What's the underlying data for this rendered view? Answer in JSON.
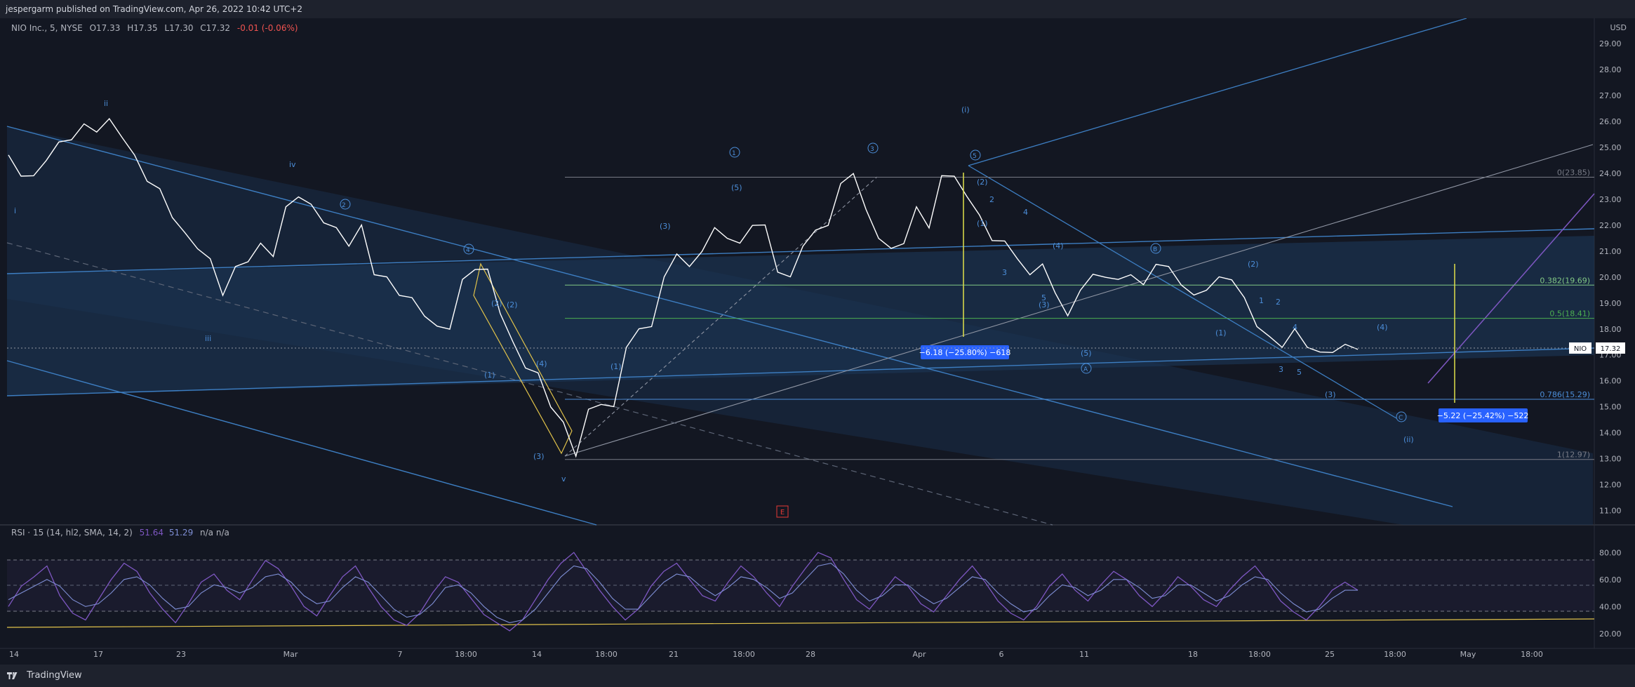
{
  "header": {
    "published": "jespergarm published on TradingView.com, Apr 26, 2022 10:42 UTC+2"
  },
  "legend": {
    "symbol": "NIO Inc., 5, NYSE",
    "open": "O17.33",
    "high": "H17.35",
    "low": "L17.30",
    "close": "C17.32",
    "change": "-0.01 (-0.06%)"
  },
  "currency": "USD",
  "price_tag": {
    "symbol": "NIO",
    "price": "17.32"
  },
  "rsi_legend": {
    "label": "RSI · 15 (14, hl2, SMA, 14, 2)",
    "v1": "51.64",
    "v2": "51.29",
    "na": "n/a  n/a"
  },
  "footer": {
    "brand": "TradingView"
  },
  "chart_data": [
    {
      "type": "line",
      "title": "NIO Inc., 5, NYSE",
      "x_ticks": [
        "14",
        "17",
        "23",
        "Mar",
        "7",
        "18:00",
        "14",
        "18:00",
        "21",
        "18:00",
        "28",
        "Apr",
        "6",
        "11",
        "18",
        "18:00",
        "25",
        "18:00",
        "May",
        "18:00"
      ],
      "y_ticks": [
        "11.00",
        "12.00",
        "13.00",
        "14.00",
        "15.00",
        "16.00",
        "17.00",
        "18.00",
        "19.00",
        "20.00",
        "21.00",
        "22.00",
        "23.00",
        "24.00",
        "25.00",
        "26.00",
        "27.00",
        "28.00",
        "29.00"
      ],
      "ylim": [
        10.5,
        29.6
      ],
      "series": [
        {
          "values": [
            24.6,
            24.0,
            23.8,
            24.6,
            25.1,
            25.4,
            25.8,
            25.7,
            26.0,
            25.5,
            24.6,
            23.8,
            23.3,
            22.4,
            21.6,
            21.2,
            20.6,
            19.4,
            20.3,
            20.7,
            21.2,
            20.9,
            22.6,
            23.2,
            22.7,
            22.2,
            21.8,
            21.3,
            21.9,
            20.2,
            19.9,
            19.4,
            19.1,
            18.6,
            18.0,
            18.1,
            19.8,
            20.4,
            20.2,
            18.7,
            17.4,
            16.6,
            16.2,
            15.1,
            14.3,
            13.2,
            14.8,
            15.2,
            14.9,
            17.4,
            17.9,
            18.2,
            19.9,
            21.0,
            20.3,
            21.1,
            21.8,
            21.6,
            21.2,
            22.1,
            21.9,
            20.3,
            19.9,
            21.3,
            21.7,
            22.1,
            23.5,
            24.1,
            22.5,
            21.6,
            21.0,
            21.4,
            22.6,
            22.0,
            23.8,
            24.0,
            23.0,
            22.5,
            21.3,
            21.5,
            20.6,
            20.2,
            20.4,
            19.5,
            18.4,
            19.6,
            20.0,
            20.1,
            19.8,
            20.2,
            19.6,
            20.6,
            20.3,
            19.8,
            19.2,
            19.6,
            19.9,
            20.0,
            19.1,
            18.2,
            17.6,
            17.4,
            17.9,
            17.4,
            17.0,
            17.2,
            17.3,
            17.32
          ]
        }
      ],
      "annotations": {
        "fib_levels": [
          {
            "label": "0(23.85)",
            "value": 23.85
          },
          {
            "label": "0.382(19.69)",
            "value": 19.69
          },
          {
            "label": "0.5(18.41)",
            "value": 18.41
          },
          {
            "label": "0.786(15.29)",
            "value": 15.29
          },
          {
            "label": "1(12.97)",
            "value": 12.97
          }
        ],
        "measure_boxes": [
          {
            "text": "−6.18 (−25.80%) −618"
          },
          {
            "text": "−5.22 (−25.42%) −522"
          }
        ],
        "waves": [
          "ii",
          "iv",
          "i",
          "iii",
          "v",
          "(i)",
          "(ii)",
          "(1)",
          "(2)",
          "(3)",
          "(4)",
          "(5)",
          "1",
          "2",
          "3",
          "4",
          "5",
          "A",
          "B",
          "C"
        ],
        "event_marker": "E"
      }
    },
    {
      "type": "line",
      "title": "RSI · 15 (14, hl2, SMA, 14, 2)",
      "y_ticks": [
        "20.00",
        "40.00",
        "60.00",
        "80.00"
      ],
      "ylim": [
        10,
        90
      ],
      "bands": [
        30,
        50,
        70
      ],
      "series": [
        {
          "name": "RSI",
          "values": [
            40,
            55,
            62,
            70,
            48,
            35,
            30,
            45,
            60,
            72,
            66,
            50,
            38,
            28,
            42,
            58,
            64,
            52,
            45,
            60,
            74,
            68,
            55,
            40,
            33,
            48,
            62,
            70,
            54,
            40,
            30,
            26,
            35,
            50,
            62,
            58,
            46,
            34,
            28,
            22,
            30,
            45,
            60,
            72,
            80,
            66,
            52,
            40,
            30,
            38,
            55,
            66,
            72,
            60,
            48,
            44,
            58,
            70,
            62,
            50,
            40,
            55,
            68,
            80,
            76,
            60,
            45,
            38,
            50,
            62,
            55,
            42,
            36,
            48,
            60,
            70,
            58,
            44,
            35,
            30,
            40,
            55,
            64,
            52,
            44,
            56,
            66,
            60,
            48,
            40,
            50,
            62,
            55,
            45,
            40,
            52,
            62,
            70,
            58,
            44,
            36,
            30,
            40,
            52,
            58,
            52
          ]
        },
        {
          "name": "MA",
          "values": [
            45,
            50,
            55,
            60,
            55,
            45,
            40,
            42,
            50,
            60,
            62,
            56,
            46,
            38,
            40,
            50,
            56,
            54,
            50,
            54,
            62,
            64,
            58,
            48,
            42,
            44,
            54,
            62,
            58,
            48,
            38,
            32,
            34,
            42,
            54,
            56,
            50,
            40,
            32,
            28,
            30,
            38,
            50,
            62,
            70,
            68,
            58,
            46,
            38,
            38,
            48,
            58,
            64,
            62,
            54,
            48,
            54,
            62,
            60,
            54,
            46,
            50,
            60,
            70,
            72,
            64,
            52,
            44,
            48,
            56,
            56,
            48,
            42,
            46,
            54,
            62,
            60,
            50,
            42,
            36,
            38,
            48,
            56,
            54,
            48,
            52,
            60,
            60,
            54,
            46,
            48,
            56,
            56,
            50,
            44,
            48,
            56,
            62,
            60,
            50,
            42,
            36,
            38,
            46,
            52,
            52
          ]
        }
      ]
    }
  ],
  "colors": {
    "background": "#131722",
    "price_line": "#ffffff",
    "wave_label": "#4c8ed9",
    "channel_fill": "#1d3a5c",
    "fib_green": "#81c784",
    "measure": "#2962ff",
    "rsi_line": "#7e57c2",
    "rsi_ma": "#7e8ed4",
    "trend_yellow": "#e0c24a"
  }
}
